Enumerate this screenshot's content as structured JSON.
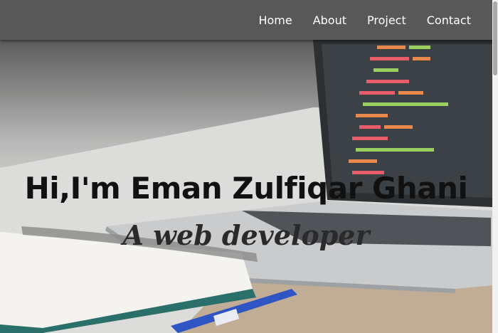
{
  "nav": {
    "items": [
      {
        "label": "Home"
      },
      {
        "label": "About"
      },
      {
        "label": "Project"
      },
      {
        "label": "Contact"
      }
    ]
  },
  "hero": {
    "headline": "Hi,I'm Eman Zulfiqar Ghani",
    "subline": "A web developer"
  },
  "colors": {
    "navbar": "#585858",
    "nav_text": "#ffffff",
    "headline": "#111111",
    "subline": "#2a2a2a"
  }
}
